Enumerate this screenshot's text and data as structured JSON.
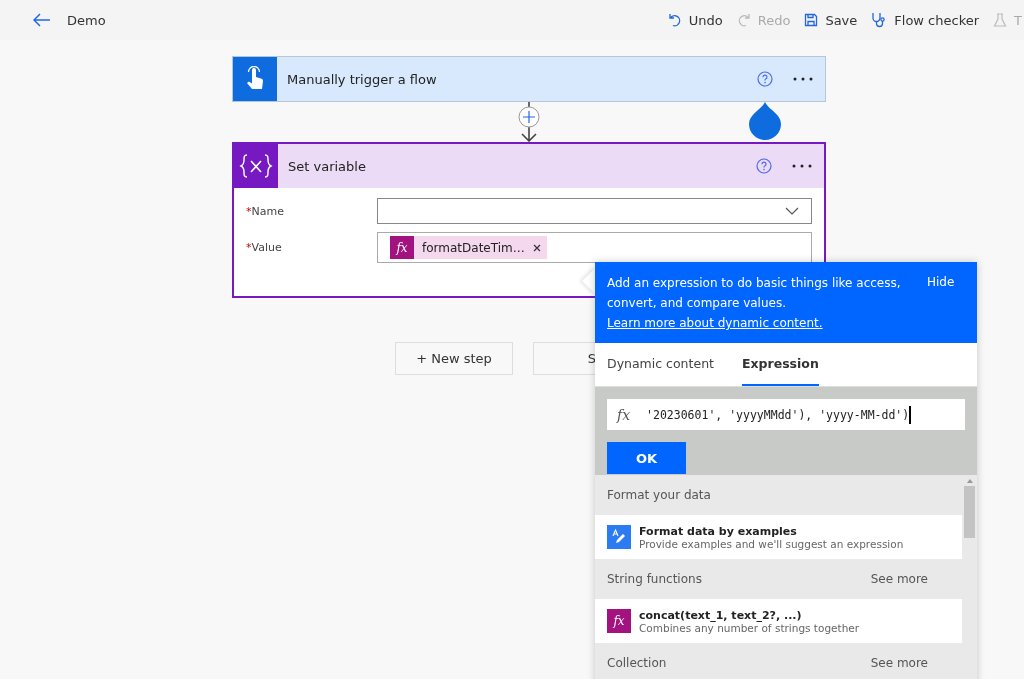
{
  "header": {
    "title": "Demo",
    "actions": [
      {
        "label": "Undo",
        "disabled": false
      },
      {
        "label": "Redo",
        "disabled": true
      },
      {
        "label": "Save",
        "disabled": false
      },
      {
        "label": "Flow checker",
        "disabled": false
      },
      {
        "label": "T",
        "disabled": true
      }
    ]
  },
  "trigger": {
    "title": "Manually trigger a flow"
  },
  "action": {
    "title": "Set variable",
    "fields": [
      {
        "label": "Name",
        "required_mark": "*",
        "kind": "dropdown"
      },
      {
        "label": "Value",
        "required_mark": "*",
        "kind": "tokens",
        "tokens": [
          {
            "icon": "fx",
            "label": "formatDateTim…"
          }
        ]
      }
    ]
  },
  "buttons": [
    "+ New step",
    "S"
  ],
  "expression_panel": {
    "info": "Add an expression to do basic things like access, convert, and compare values.",
    "link": "Learn more about dynamic content.",
    "hide": "Hide",
    "tabs": [
      {
        "label": "Dynamic content",
        "selected": false
      },
      {
        "label": "Expression",
        "selected": true
      }
    ],
    "fx_label": "fx",
    "expression": "'20230601', 'yyyyMMdd'), 'yyyy-MM-dd')",
    "ok": "OK",
    "sections": [
      {
        "title": "Format your data",
        "items": [
          {
            "kind": "example",
            "title": "Format data by examples",
            "description": "Provide examples and we'll suggest an expression"
          }
        ]
      },
      {
        "title": "String functions",
        "see_more": "See more",
        "items": [
          {
            "kind": "function",
            "icon": "fx",
            "title": "concat(text_1, text_2?, ...)",
            "description": "Combines any number of strings together"
          }
        ]
      },
      {
        "title": "Collection",
        "see_more": "See more"
      }
    ]
  }
}
